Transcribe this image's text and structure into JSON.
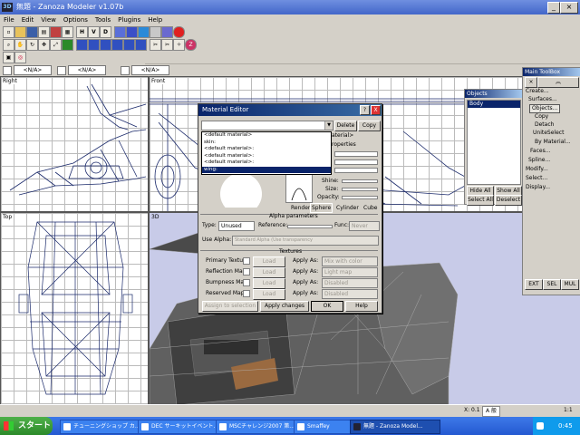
{
  "window": {
    "app_icon": "3D",
    "title": "無題 - Zanoza Modeler v1.07b"
  },
  "menu": [
    "File",
    "Edit",
    "View",
    "Options",
    "Tools",
    "Plugins",
    "Help"
  ],
  "toolbar1": [
    "H",
    "V",
    "D"
  ],
  "view_select_label": "<N/A>",
  "viewports": {
    "right": "Right",
    "front": "Front",
    "top": "Top",
    "3d": "3D"
  },
  "objects_panel": {
    "title": "Objects",
    "items": [
      "Body"
    ],
    "hide_all": "Hide All",
    "show_all": "Show All",
    "select_all": "Select All",
    "deselect": "Deselect"
  },
  "toolbox": {
    "title": "Main ToolBox",
    "items": [
      "Create...",
      "Surfaces...",
      "Objects...",
      "Copy",
      "Detach",
      "UniteSelect",
      "By Material...",
      "Faces...",
      "Spline...",
      "Modify...",
      "Select...",
      "Display..."
    ],
    "bottom_buttons": [
      "EXT",
      "SEL",
      "MUL"
    ]
  },
  "material_editor": {
    "title": "Material Editor",
    "help_button": "?",
    "close_button": "X",
    "delete": "Delete",
    "copy": "Copy",
    "dropdown_items": [
      "<default material>",
      "skin:",
      "<default material>:",
      "<default material>:",
      "<default material>:",
      "wing:"
    ],
    "material_label": "aterial>",
    "properties_label": "roperties",
    "shine": "Shine:",
    "size": "Size:",
    "opacity": "Opacity:",
    "preview_tabs": [
      "Render",
      "Sphere",
      "Cylinder",
      "Cube"
    ],
    "alpha_parameters": "Alpha parameters",
    "type_label": "Type:",
    "type_value": "Unused",
    "reference": "Reference:",
    "func": "Func:",
    "func_value": "Never",
    "use_alpha": "Use Alpha:",
    "use_alpha_value": "Standard Alpha (Use transparency",
    "textures": "Textures",
    "texture_rows": [
      "Primary Texture",
      "Reflection Map",
      "Bumpness Map",
      "Reserved Map"
    ],
    "load_map": "Load Map...",
    "apply_as": "Apply As:",
    "apply_as_values": [
      "Mix with color",
      "Light map",
      "Disabled",
      "Disabled"
    ],
    "assign_to_selection": "Assign to selection",
    "apply_changes": "Apply changes",
    "ok": "OK",
    "help": "Help"
  },
  "taskbar": {
    "start": "スタート",
    "tasks": [
      "チューニングショップ カ...",
      "DEC サーキットイベント...",
      "MSCチャレンジ2007 第...",
      "Smaffey",
      "無題 - Zanoza Model..."
    ],
    "lang": "A 般",
    "clock": "0:45"
  },
  "status": {
    "coords": "X: 0.1",
    "zoom": "1:1"
  },
  "colors": {
    "titlebar": "#4266c9",
    "dialog_caption": "#0a246a",
    "taskbar": "#2459d1",
    "wireframe": "#1b2a6b",
    "view3d_bg": "#c8cbe8"
  }
}
